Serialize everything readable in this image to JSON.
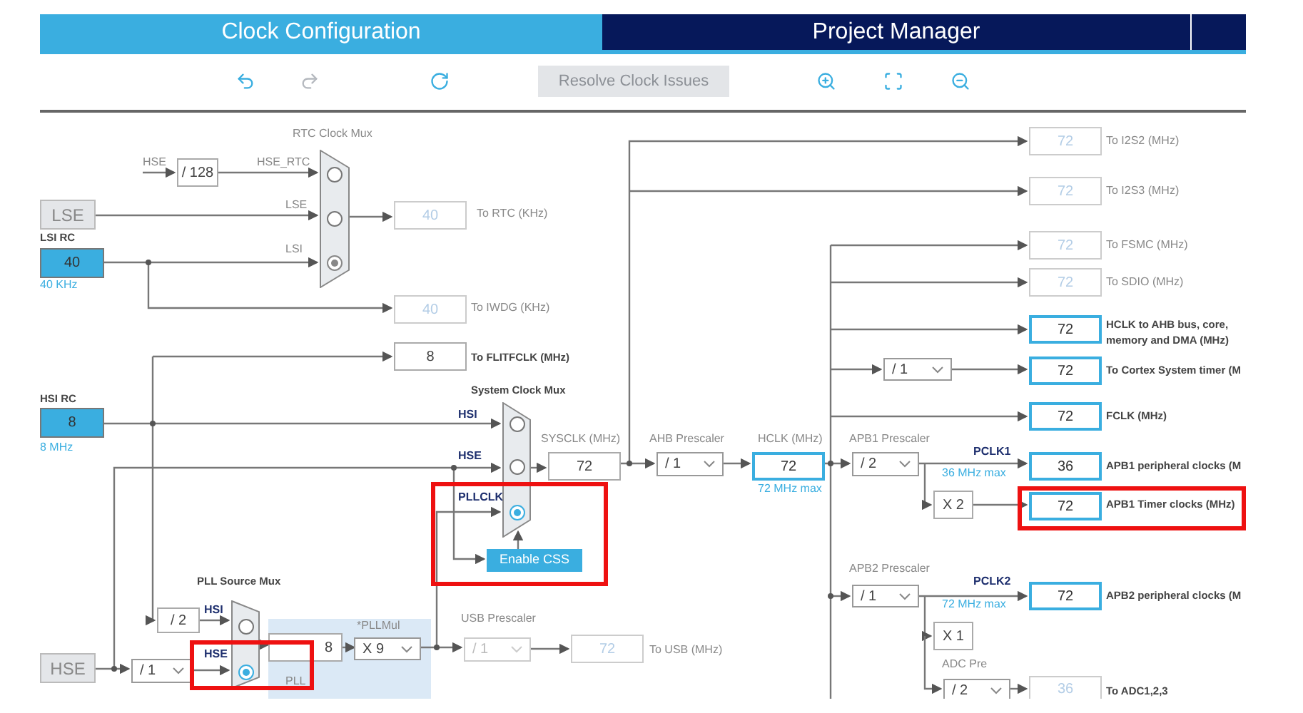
{
  "tabs": [
    {
      "label": "Clock Configuration",
      "selected": true
    },
    {
      "label": "Project Manager",
      "selected": false
    }
  ],
  "toolbar": [
    {
      "kind": "undo",
      "disabled": false
    },
    {
      "kind": "redo",
      "disabled": true
    },
    {
      "kind": "refresh",
      "disabled": false
    },
    {
      "kind": "button",
      "label": "Resolve Clock Issues",
      "disabled": true
    },
    {
      "kind": "zoom_in",
      "disabled": false
    },
    {
      "kind": "fit",
      "disabled": false
    },
    {
      "kind": "zoom_out",
      "disabled": false
    }
  ],
  "diagram": {
    "labels": [
      {
        "text": "RTC Clock Mux",
        "kind": "muted"
      },
      {
        "text": "HSE",
        "kind": "muted"
      },
      {
        "text": "HSE_RTC",
        "kind": "muted"
      },
      {
        "text": "LSE",
        "kind": "muted"
      },
      {
        "text": "LSI",
        "kind": "muted"
      },
      {
        "text": "LSI RC",
        "kind": "strong"
      },
      {
        "text": "40 KHz",
        "kind": "note"
      },
      {
        "text": "To RTC (KHz)",
        "kind": "muted"
      },
      {
        "text": "To IWDG (KHz)",
        "kind": "muted"
      },
      {
        "text": "To FLITFCLK (MHz)",
        "kind": "strong"
      },
      {
        "text": "System Clock Mux",
        "kind": "strong"
      },
      {
        "text": "HSI RC",
        "kind": "strong"
      },
      {
        "text": "8 MHz",
        "kind": "note"
      },
      {
        "text": "HSI",
        "kind": "signal"
      },
      {
        "text": "HSE",
        "kind": "signal"
      },
      {
        "text": "PLLCLK",
        "kind": "signal"
      },
      {
        "text": "SYSCLK (MHz)",
        "kind": "muted"
      },
      {
        "text": "AHB Prescaler",
        "kind": "muted"
      },
      {
        "text": "HCLK (MHz)",
        "kind": "muted"
      },
      {
        "text": "72 MHz max",
        "kind": "note"
      },
      {
        "text": "APB1 Prescaler",
        "kind": "muted"
      },
      {
        "text": "PCLK1",
        "kind": "signal"
      },
      {
        "text": "36 MHz max",
        "kind": "note"
      },
      {
        "text": "To I2S2 (MHz)",
        "kind": "muted"
      },
      {
        "text": "To I2S3 (MHz)",
        "kind": "muted"
      },
      {
        "text": "To FSMC (MHz)",
        "kind": "muted"
      },
      {
        "text": "To SDIO (MHz)",
        "kind": "muted"
      },
      {
        "text": "HCLK to AHB bus, core,",
        "kind": "strong"
      },
      {
        "text": "memory and DMA (MHz)",
        "kind": "strong"
      },
      {
        "text": "To Cortex System timer (M",
        "kind": "strong"
      },
      {
        "text": "FCLK (MHz)",
        "kind": "strong"
      },
      {
        "text": "APB1 peripheral clocks (M",
        "kind": "strong"
      },
      {
        "text": "APB1 Timer clocks (MHz)",
        "kind": "strong"
      },
      {
        "text": "APB2 Prescaler",
        "kind": "muted"
      },
      {
        "text": "PCLK2",
        "kind": "signal"
      },
      {
        "text": "72 MHz max",
        "kind": "note"
      },
      {
        "text": "APB2 peripheral clocks (M",
        "kind": "strong"
      },
      {
        "text": "ADC Pre",
        "kind": "muted"
      },
      {
        "text": "To ADC1,2,3",
        "kind": "strong"
      },
      {
        "text": "PLL Source Mux",
        "kind": "strong"
      },
      {
        "text": "HSI",
        "kind": "signal"
      },
      {
        "text": "HSE",
        "kind": "signal"
      },
      {
        "text": "*PLLMul",
        "kind": "muted"
      },
      {
        "text": "PLL",
        "kind": "muted"
      },
      {
        "text": "USB Prescaler",
        "kind": "muted"
      },
      {
        "text": "To USB (MHz)",
        "kind": "muted"
      }
    ],
    "boxes": [
      {
        "value": "/ 128",
        "kind": "plain"
      },
      {
        "value": "LSE",
        "kind": "source_off"
      },
      {
        "value": "40",
        "kind": "source"
      },
      {
        "value": "40",
        "kind": "inactive"
      },
      {
        "value": "40",
        "kind": "inactive"
      },
      {
        "value": "8",
        "kind": "plain"
      },
      {
        "value": "8",
        "kind": "source"
      },
      {
        "value": "72",
        "kind": "plain"
      },
      {
        "value": "72",
        "kind": "active"
      },
      {
        "value": "72",
        "kind": "inactive"
      },
      {
        "value": "72",
        "kind": "inactive"
      },
      {
        "value": "72",
        "kind": "inactive"
      },
      {
        "value": "72",
        "kind": "inactive"
      },
      {
        "value": "72",
        "kind": "active"
      },
      {
        "value": "72",
        "kind": "active"
      },
      {
        "value": "72",
        "kind": "active"
      },
      {
        "value": "36",
        "kind": "active"
      },
      {
        "value": "X 2",
        "kind": "plain"
      },
      {
        "value": "72",
        "kind": "active"
      },
      {
        "value": "72",
        "kind": "active"
      },
      {
        "value": "X 1",
        "kind": "plain"
      },
      {
        "value": "36",
        "kind": "inactive"
      },
      {
        "value": "/ 2",
        "kind": "plain"
      },
      {
        "value": "HSE",
        "kind": "source_off"
      },
      {
        "value": "8",
        "kind": "plain"
      },
      {
        "value": "72",
        "kind": "inactive"
      }
    ],
    "dropdowns": [
      {
        "value": "/ 1",
        "disabled": false
      },
      {
        "value": "/ 2",
        "disabled": false
      },
      {
        "value": "/ 1",
        "disabled": false
      },
      {
        "value": "/ 1",
        "disabled": false
      },
      {
        "value": "/ 2",
        "disabled": false
      },
      {
        "value": "/ 1",
        "disabled": false
      },
      {
        "value": "X 9",
        "disabled": false
      },
      {
        "value": "/ 1",
        "disabled": true
      }
    ],
    "muxes": [
      {
        "options": [
          {
            "selected": false
          },
          {
            "selected": false
          },
          {
            "selected": true
          }
        ]
      },
      {
        "options": [
          {
            "selected": false
          },
          {
            "selected": false
          },
          {
            "selected": true
          }
        ]
      },
      {
        "options": [
          {
            "selected": false
          },
          {
            "selected": true
          }
        ]
      }
    ],
    "css_button": {
      "label": "Enable CSS"
    }
  }
}
